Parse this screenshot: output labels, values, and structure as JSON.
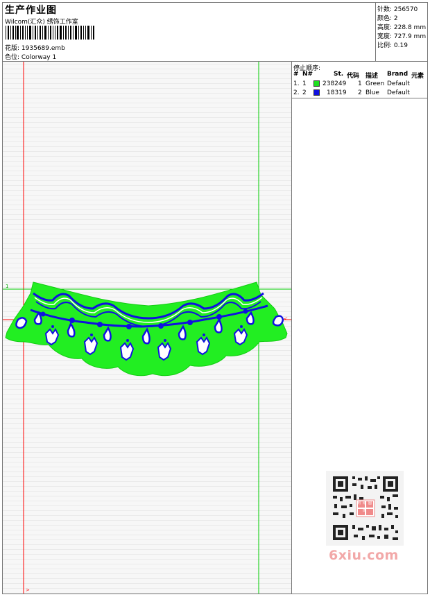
{
  "header": {
    "title": "生产作业图",
    "company": "Wilcom(汇众) 绣饰工作室",
    "design_label": "花版:",
    "design_file": "1935689.emb",
    "colorway_label": "色位:",
    "colorway_name": "Colorway 1"
  },
  "stats": [
    {
      "label": "针数:",
      "value": "256570"
    },
    {
      "label": "颜色:",
      "value": "2"
    },
    {
      "label": "高度:",
      "value": "228.8 mm"
    },
    {
      "label": "宽度:",
      "value": "727.9 mm"
    },
    {
      "label": "比例:",
      "value": "0.19"
    }
  ],
  "stop_sequence": {
    "title": "停止顺序:",
    "columns": [
      "#",
      "N#",
      "St.",
      "代码",
      "描述",
      "Brand",
      "元素"
    ],
    "rows": [
      {
        "index": "1.",
        "n": "1",
        "color": "#1ee01e",
        "stitches": "238249",
        "code": "1",
        "description": "Green",
        "brand": "Default"
      },
      {
        "index": "2.",
        "n": "2",
        "color": "#1010e0",
        "stitches": "18319",
        "code": "2",
        "description": "Blue",
        "brand": "Default"
      }
    ]
  },
  "colors": {
    "fill_green": "#22ee22",
    "outline_blue": "#1010e0",
    "guide_red": "#ff0000",
    "guide_green": "#00cc00"
  },
  "watermark": {
    "site": "6xiu.com",
    "stamp": "刺绣图库"
  }
}
